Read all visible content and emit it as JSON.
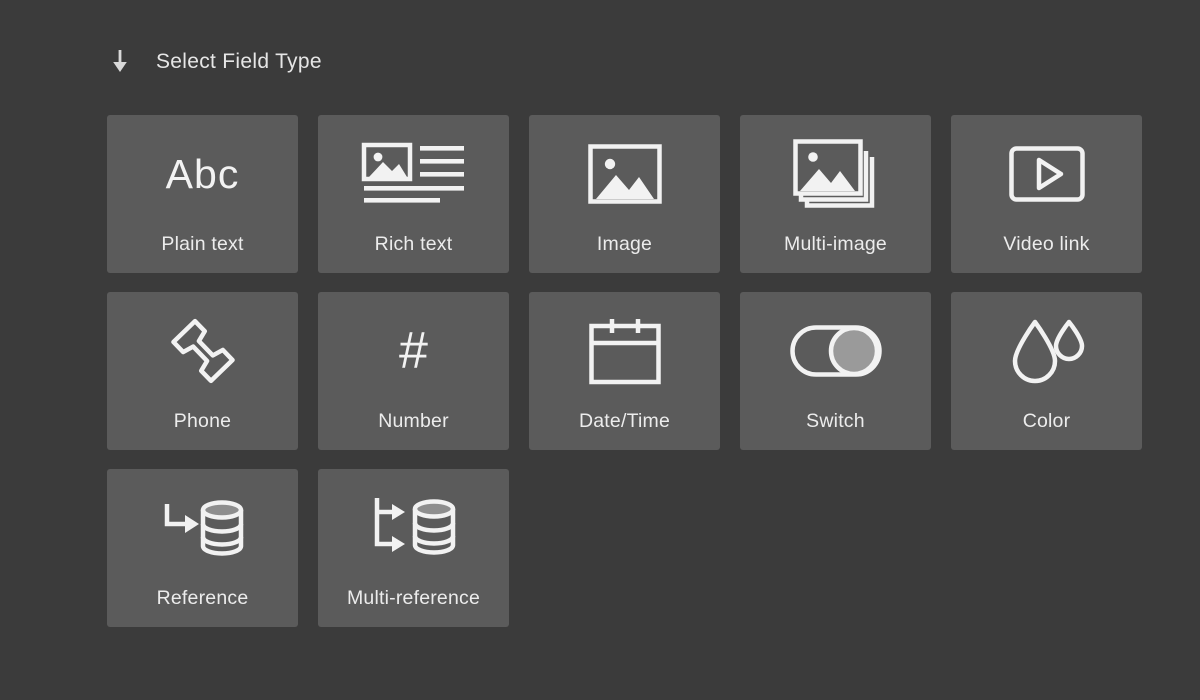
{
  "header": {
    "arrow_icon": "arrow-down-icon",
    "title": "Select Field Type"
  },
  "colors": {
    "background": "#3b3b3b",
    "card": "#5b5b5b",
    "text": "#ececec",
    "icon": "#f2f2f2",
    "switch_knob": "#9a9a9a"
  },
  "field_types": [
    {
      "id": "plain-text",
      "label": "Plain text",
      "icon": "abc-text-icon"
    },
    {
      "id": "rich-text",
      "label": "Rich text",
      "icon": "rich-text-icon"
    },
    {
      "id": "image",
      "label": "Image",
      "icon": "image-icon"
    },
    {
      "id": "multi-image",
      "label": "Multi-image",
      "icon": "multi-image-icon"
    },
    {
      "id": "video-link",
      "label": "Video link",
      "icon": "video-play-icon"
    },
    {
      "id": "phone",
      "label": "Phone",
      "icon": "phone-icon"
    },
    {
      "id": "number",
      "label": "Number",
      "icon": "hash-icon"
    },
    {
      "id": "date-time",
      "label": "Date/Time",
      "icon": "calendar-icon"
    },
    {
      "id": "switch",
      "label": "Switch",
      "icon": "toggle-switch-icon"
    },
    {
      "id": "color",
      "label": "Color",
      "icon": "water-drops-icon"
    },
    {
      "id": "reference",
      "label": "Reference",
      "icon": "database-arrow-icon"
    },
    {
      "id": "multi-reference",
      "label": "Multi-reference",
      "icon": "database-branch-arrow-icon"
    }
  ],
  "glyphs": {
    "abc": "Abc",
    "hash": "#"
  }
}
